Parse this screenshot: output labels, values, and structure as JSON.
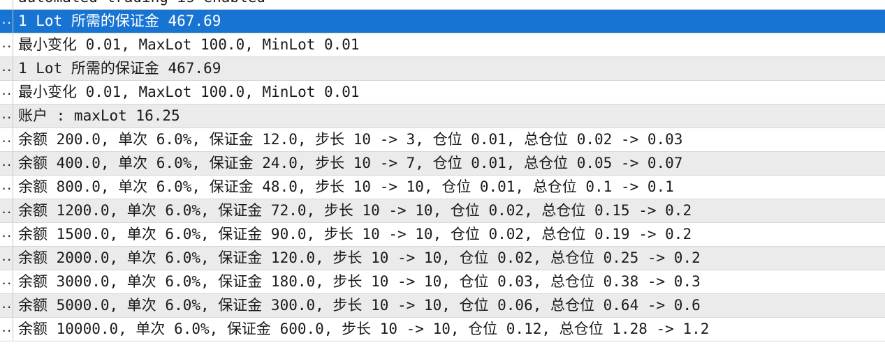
{
  "stub_text": "..",
  "rows": [
    {
      "text": "automated trading is enabled",
      "style": "plain"
    },
    {
      "text": "1 Lot 所需的保证金 467.69",
      "style": "selected"
    },
    {
      "text": "最小变化 0.01, MaxLot 100.0, MinLot 0.01",
      "style": "plain"
    },
    {
      "text": "1 Lot 所需的保证金 467.69",
      "style": "alt"
    },
    {
      "text": "最小变化 0.01, MaxLot 100.0, MinLot 0.01",
      "style": "plain"
    },
    {
      "text": "账户 : maxLot 16.25",
      "style": "alt"
    },
    {
      "text": "余额 200.0, 单次 6.0%, 保证金 12.0, 步长 10 -> 3, 仓位 0.01, 总仓位 0.02 -> 0.03",
      "style": "plain"
    },
    {
      "text": "余额 400.0, 单次 6.0%, 保证金 24.0, 步长 10 -> 7, 仓位 0.01, 总仓位 0.05 -> 0.07",
      "style": "alt"
    },
    {
      "text": "余额 800.0, 单次 6.0%, 保证金 48.0, 步长 10 -> 10, 仓位 0.01, 总仓位 0.1 -> 0.1",
      "style": "plain"
    },
    {
      "text": "余额 1200.0, 单次 6.0%, 保证金 72.0, 步长 10 -> 10, 仓位 0.02, 总仓位 0.15 -> 0.2",
      "style": "alt"
    },
    {
      "text": "余额 1500.0, 单次 6.0%, 保证金 90.0, 步长 10 -> 10, 仓位 0.02, 总仓位 0.19 -> 0.2",
      "style": "plain"
    },
    {
      "text": "余额 2000.0, 单次 6.0%, 保证金 120.0, 步长 10 -> 10, 仓位 0.02, 总仓位 0.25 -> 0.2",
      "style": "alt"
    },
    {
      "text": "余额 3000.0, 单次 6.0%, 保证金 180.0, 步长 10 -> 10, 仓位 0.03, 总仓位 0.38 -> 0.3",
      "style": "plain"
    },
    {
      "text": "余额 5000.0, 单次 6.0%, 保证金 300.0, 步长 10 -> 10, 仓位 0.06, 总仓位 0.64 -> 0.6",
      "style": "alt"
    },
    {
      "text": "余额 10000.0, 单次 6.0%, 保证金 600.0, 步长 10 -> 10, 仓位 0.12, 总仓位 1.28 -> 1.2",
      "style": "plain"
    }
  ]
}
